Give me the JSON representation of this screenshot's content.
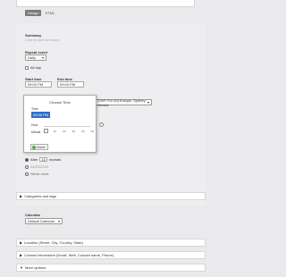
{
  "editor": {
    "tab_design": "Design",
    "tab_html": "HTML"
  },
  "summary": {
    "label": "Summary",
    "placeholder": "Click to add summary"
  },
  "repeat": {
    "label": "Repeat event",
    "value": "Daily"
  },
  "allday": {
    "label": "All day"
  },
  "start": {
    "label": "Start time",
    "value": "09:00 PM"
  },
  "end": {
    "label": "End time",
    "value": "09:00 PM"
  },
  "timezone": {
    "value": "(GMT+01:00) Europe, Sydney, Vienna"
  },
  "time_picker": {
    "title": "Choose Time",
    "time_label": "Time",
    "time_value": "09:00 PM",
    "hour_label": "Hour",
    "minute_label": "Minute",
    "minute_ticks": [
      "00",
      "10",
      "20",
      "30",
      "40",
      "50"
    ],
    "done_label": "Done"
  },
  "ends": {
    "after_prefix": "After",
    "after_count": "10",
    "after_suffix": "repeats",
    "on_date": "04/20/2015",
    "never_label": "Never ends"
  },
  "sections": {
    "categories": "Categories and tags",
    "location": "Location (Street, City, Country, State)",
    "contact": "Contact Information (Email, Web, Contact name, Phone)",
    "more": "More options"
  },
  "calendar": {
    "label": "Calendar",
    "value": "Default Calendar"
  },
  "colors": {
    "accent": "#2f6fc4",
    "done_icon": "#4a9d3d"
  }
}
